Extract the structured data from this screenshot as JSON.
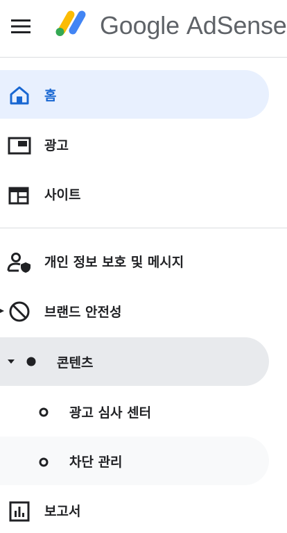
{
  "header": {
    "menu_icon": "hamburger-menu-icon",
    "logo_icon": "adsense-logo-icon",
    "brand_google": "Google",
    "brand_product": "AdSense"
  },
  "nav": {
    "home": {
      "label": "홈",
      "icon": "home-icon"
    },
    "ads": {
      "label": "광고",
      "icon": "ad-unit-icon"
    },
    "sites": {
      "label": "사이트",
      "icon": "site-layout-icon"
    },
    "privacy": {
      "label": "개인 정보 보호 및 메시지",
      "icon": "person-shield-icon"
    },
    "brand_safety": {
      "label": "브랜드 안전성",
      "icon": "block-icon"
    },
    "content": {
      "label": "콘텐츠",
      "icon": "filled-dot-icon"
    },
    "ad_review": {
      "label": "광고 심사 센터",
      "icon": "hollow-dot-icon"
    },
    "blocking": {
      "label": "차단 관리",
      "icon": "hollow-dot-icon"
    },
    "reports": {
      "label": "보고서",
      "icon": "bar-chart-icon"
    }
  },
  "colors": {
    "active_bg": "#e8f0fe",
    "active_text": "#1967d2",
    "expanded_bg": "#e8eaed",
    "hover_bg": "#f8f9fa",
    "text": "#202124",
    "divider": "#dadce0"
  }
}
